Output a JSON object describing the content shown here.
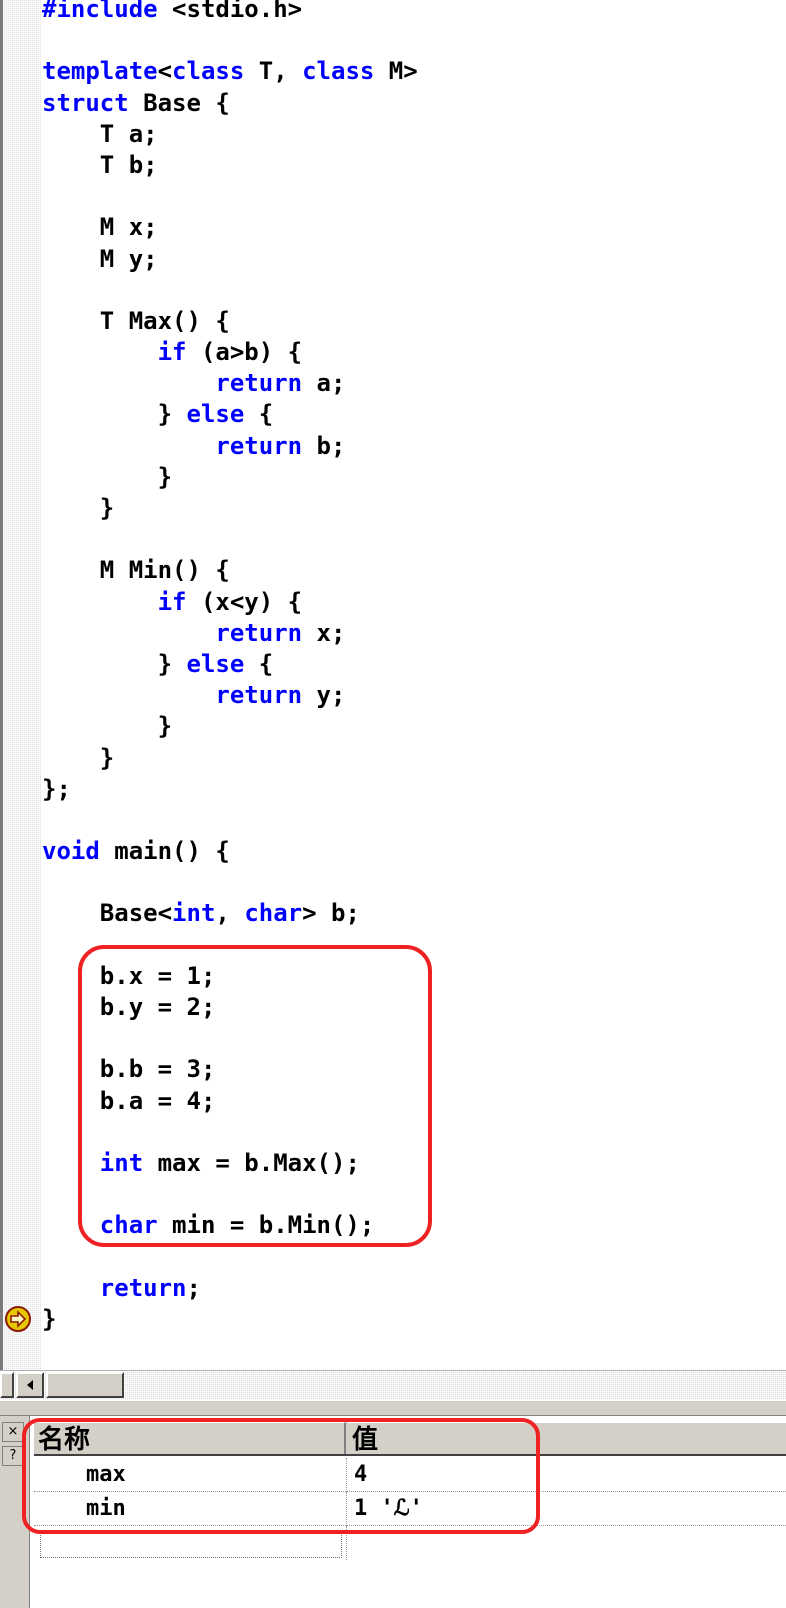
{
  "editor": {
    "lines": [
      [
        {
          "t": "#include",
          "k": true
        },
        {
          "t": " <stdio.h>"
        }
      ],
      [],
      [
        {
          "t": "template",
          "k": true
        },
        {
          "t": "<"
        },
        {
          "t": "class",
          "k": true
        },
        {
          "t": " T, "
        },
        {
          "t": "class",
          "k": true
        },
        {
          "t": " M>"
        }
      ],
      [
        {
          "t": "struct",
          "k": true
        },
        {
          "t": " Base {"
        }
      ],
      [
        {
          "t": "    T a;"
        }
      ],
      [
        {
          "t": "    T b;"
        }
      ],
      [],
      [
        {
          "t": "    M x;"
        }
      ],
      [
        {
          "t": "    M y;"
        }
      ],
      [],
      [
        {
          "t": "    T Max() {"
        }
      ],
      [
        {
          "t": "        "
        },
        {
          "t": "if",
          "k": true
        },
        {
          "t": " (a>b) {"
        }
      ],
      [
        {
          "t": "            "
        },
        {
          "t": "return",
          "k": true
        },
        {
          "t": " a;"
        }
      ],
      [
        {
          "t": "        } "
        },
        {
          "t": "else",
          "k": true
        },
        {
          "t": " {"
        }
      ],
      [
        {
          "t": "            "
        },
        {
          "t": "return",
          "k": true
        },
        {
          "t": " b;"
        }
      ],
      [
        {
          "t": "        }"
        }
      ],
      [
        {
          "t": "    }"
        }
      ],
      [],
      [
        {
          "t": "    M Min() {"
        }
      ],
      [
        {
          "t": "        "
        },
        {
          "t": "if",
          "k": true
        },
        {
          "t": " (x<y) {"
        }
      ],
      [
        {
          "t": "            "
        },
        {
          "t": "return",
          "k": true
        },
        {
          "t": " x;"
        }
      ],
      [
        {
          "t": "        } "
        },
        {
          "t": "else",
          "k": true
        },
        {
          "t": " {"
        }
      ],
      [
        {
          "t": "            "
        },
        {
          "t": "return",
          "k": true
        },
        {
          "t": " y;"
        }
      ],
      [
        {
          "t": "        }"
        }
      ],
      [
        {
          "t": "    }"
        }
      ],
      [
        {
          "t": "};"
        }
      ],
      [],
      [
        {
          "t": "void",
          "k": true
        },
        {
          "t": " main() {"
        }
      ],
      [],
      [
        {
          "t": "    Base<"
        },
        {
          "t": "int",
          "k": true
        },
        {
          "t": ", "
        },
        {
          "t": "char",
          "k": true
        },
        {
          "t": "> b;"
        }
      ],
      [],
      [
        {
          "t": "    b.x = 1;"
        }
      ],
      [
        {
          "t": "    b.y = 2;"
        }
      ],
      [],
      [
        {
          "t": "    b.b = 3;"
        }
      ],
      [
        {
          "t": "    b.a = 4;"
        }
      ],
      [],
      [
        {
          "t": "    "
        },
        {
          "t": "int",
          "k": true
        },
        {
          "t": " max = b.Max();"
        }
      ],
      [],
      [
        {
          "t": "    "
        },
        {
          "t": "char",
          "k": true
        },
        {
          "t": " min = b.Min();"
        }
      ],
      [],
      [
        {
          "t": "    "
        },
        {
          "t": "return",
          "k": true
        },
        {
          "t": ";"
        }
      ],
      [
        {
          "t": "}"
        }
      ]
    ],
    "colors": {
      "keyword": "#0000ff",
      "text": "#000000",
      "highlight": "#ee2222"
    },
    "breakpoint_icon": "current-line-arrow-icon"
  },
  "watch": {
    "side_buttons": [
      "×",
      "?"
    ],
    "headers": {
      "name": "名称",
      "value": "值"
    },
    "rows": [
      {
        "name": "max",
        "value": "4"
      },
      {
        "name": "min",
        "value": "1 'ℒ'"
      }
    ]
  }
}
